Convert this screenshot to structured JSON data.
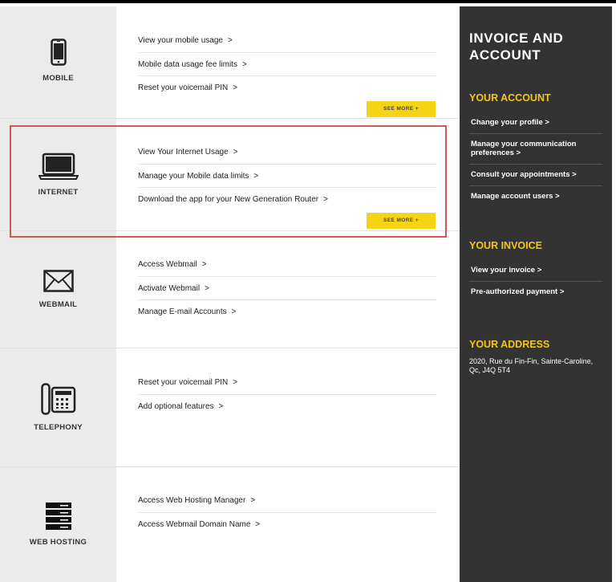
{
  "sections": [
    {
      "name": "MOBILE",
      "links": [
        "View your mobile usage",
        "Mobile data usage fee limits",
        "Reset your voicemail PIN"
      ],
      "see_more": "SEE MORE +"
    },
    {
      "name": "INTERNET",
      "links": [
        "View Your Internet Usage",
        "Manage your Mobile data limits",
        "Download the app for your New Generation Router"
      ],
      "see_more": "SEE MORE +"
    },
    {
      "name": "WEBMAIL",
      "links": [
        "Access Webmail",
        "Activate Webmail",
        "Manage E-mail Accounts"
      ]
    },
    {
      "name": "TELEPHONY",
      "links": [
        "Reset your voicemail PIN",
        "Add optional features"
      ]
    },
    {
      "name": "WEB HOSTING",
      "links": [
        "Access Web Hosting Manager",
        "Access Webmail Domain Name"
      ]
    }
  ],
  "chevron": ">",
  "sidebar": {
    "title": "INVOICE AND ACCOUNT",
    "account": {
      "heading": "YOUR ACCOUNT",
      "links": [
        "Change your profile",
        "Manage your communication preferences",
        "Consult your appointments",
        "Manage account users"
      ]
    },
    "invoice": {
      "heading": "YOUR INVOICE",
      "links": [
        "View your invoice",
        "Pre-authorized payment"
      ]
    },
    "address": {
      "heading": "YOUR ADDRESS",
      "text": "2020, Rue du Fin-Fin, Sainte-Caroline, Qc, J4Q 5T4"
    }
  },
  "colors": {
    "accent": "#f5d416",
    "sidebar_bg": "#333333",
    "highlight": "#d9534f"
  }
}
